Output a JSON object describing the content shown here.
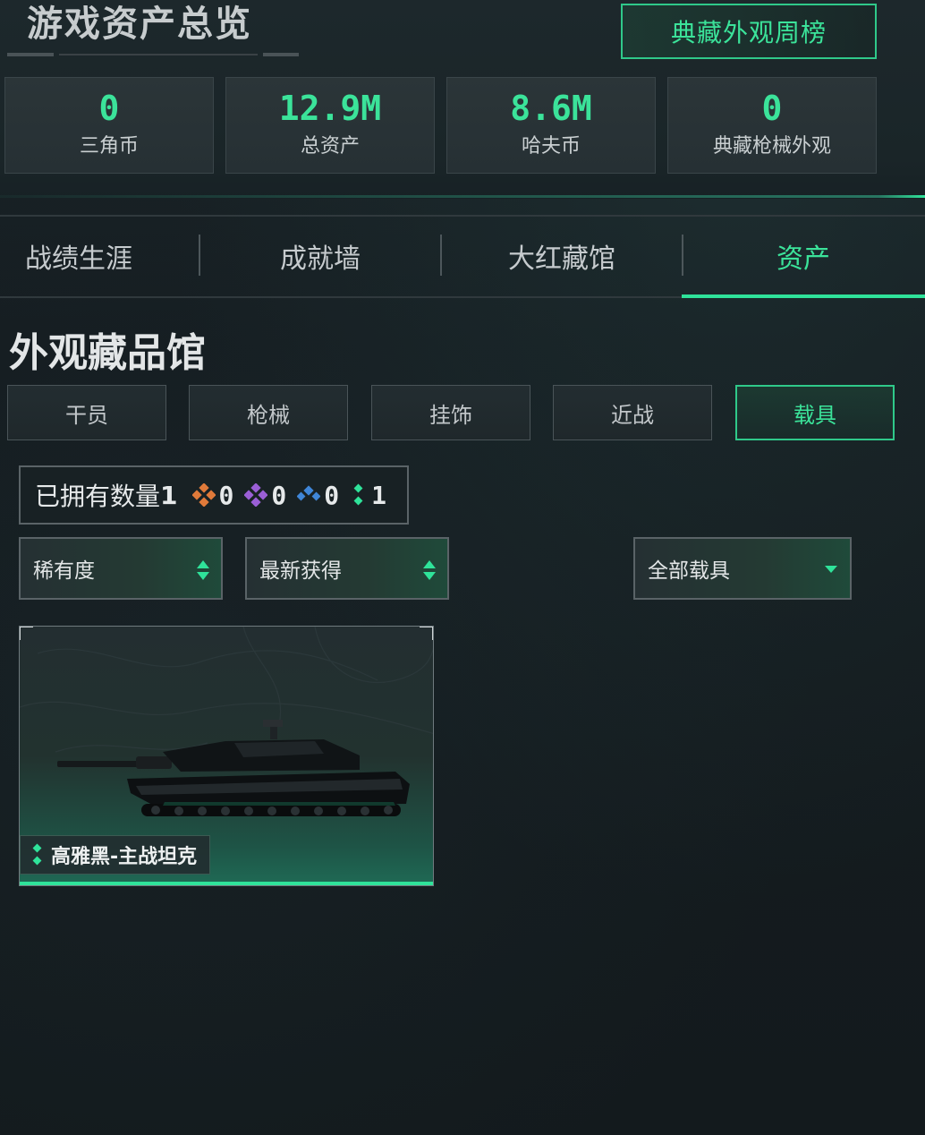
{
  "header": {
    "title": "游戏资产总览",
    "weekly_button": "典藏外观周榜"
  },
  "stats": [
    {
      "value": "0",
      "label": "三角币"
    },
    {
      "value": "12.9M",
      "label": "总资产"
    },
    {
      "value": "8.6M",
      "label": "哈夫币"
    },
    {
      "value": "0",
      "label": "典藏枪械外观"
    }
  ],
  "tabs": [
    {
      "label": "战绩生涯",
      "active": false
    },
    {
      "label": "成就墙",
      "active": false
    },
    {
      "label": "大红藏馆",
      "active": false
    },
    {
      "label": "资产",
      "active": true
    }
  ],
  "section": {
    "title": "外观藏品馆"
  },
  "categories": [
    {
      "label": "干员",
      "active": false
    },
    {
      "label": "枪械",
      "active": false
    },
    {
      "label": "挂饰",
      "active": false
    },
    {
      "label": "近战",
      "active": false
    },
    {
      "label": "载具",
      "active": true
    }
  ],
  "owned": {
    "label": "已拥有数量",
    "count": "1",
    "gems": [
      {
        "icon": "orange-gem-icon",
        "value": "0",
        "color": "#e07a3a"
      },
      {
        "icon": "purple-gem-icon",
        "value": "0",
        "color": "#9b5fd6"
      },
      {
        "icon": "blue-gem-icon",
        "value": "0",
        "color": "#3f86d8"
      },
      {
        "icon": "green-gem-icon",
        "value": "1",
        "color": "#2fe39a"
      }
    ]
  },
  "filters": {
    "rarity": "稀有度",
    "sort": "最新获得",
    "vehicle_type": "全部载具"
  },
  "items": [
    {
      "name": "高雅黑-主战坦克",
      "rarity_color": "#2fe39a"
    }
  ],
  "colors": {
    "accent": "#2fe39a",
    "background": "#141b1f"
  }
}
